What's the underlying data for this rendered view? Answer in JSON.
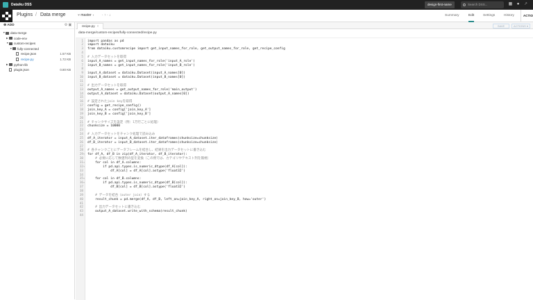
{
  "topbar": {
    "app_name": "Dataiku DSS",
    "instance_label": "design-first-name",
    "search_placeholder": "Search DSS...",
    "icons": [
      "apps-grid-icon",
      "notifications-icon",
      "user-avatar-icon",
      "activity-icon"
    ]
  },
  "header": {
    "section": "Plugins",
    "page": "Data merge",
    "branch": "master",
    "git_ops": "· ↑ · ↓",
    "tabs": [
      "Summary",
      "Edit",
      "Settings",
      "History"
    ],
    "active_tab": "Edit",
    "actions_label": "ACTIONS"
  },
  "sidebar": {
    "add_label": "ADD",
    "tree": [
      {
        "label": "data-merge",
        "type": "folder",
        "depth": 0,
        "expanded": true,
        "size": ""
      },
      {
        "label": "code-env",
        "type": "folder",
        "depth": 1,
        "expanded": false,
        "size": ""
      },
      {
        "label": "custom-recipes",
        "type": "folder",
        "depth": 1,
        "expanded": true,
        "size": ""
      },
      {
        "label": "fully-connected",
        "type": "folder",
        "depth": 2,
        "expanded": true,
        "size": ""
      },
      {
        "label": "recipe.json",
        "type": "file",
        "depth": 3,
        "size": "1.57 KB",
        "selected": false
      },
      {
        "label": "recipe.py",
        "type": "file",
        "depth": 3,
        "size": "1.72 KB",
        "selected": true
      },
      {
        "label": "python-lib",
        "type": "folder",
        "depth": 1,
        "expanded": false,
        "size": ""
      },
      {
        "label": "plugin.json",
        "type": "file",
        "depth": 1,
        "size": "0.80 KB",
        "selected": false
      }
    ]
  },
  "editor": {
    "tab_label": "recipe.py",
    "save_label": "SAVE",
    "more_label": "ACTIONS ▾",
    "file_path": "data-merge/custom-recipes/fully-connected/recipe.py",
    "lines": [
      "import pandas as pd",
      "import dataiku",
      "from dataiku.customrecipe import get_input_names_for_role, get_output_names_for_role, get_recipe_config",
      "",
      "# 入力データセットを取得",
      "input_A_names = get_input_names_for_role('input_A_role')",
      "input_B_names = get_input_names_for_role('input_B_role')",
      "",
      "input_A_dataset = dataiku.Dataset(input_A_names[0])",
      "input_B_dataset = dataiku.Dataset(input_B_names[0])",
      "",
      "# 出力データセットを取得",
      "output_A_names = get_output_names_for_role('main_output')",
      "output_A_dataset = dataiku.Dataset(output_A_names[0])",
      "",
      "# 設定されたjoin keyを取得",
      "config = get_recipe_config()",
      "join_key_A = config['join_key_A']",
      "join_key_B = config['join_key_B']",
      "",
      "# チャンクサイズを設定（例：1万行ごとに処理）",
      "chunksize = 10000",
      "",
      "# 入力データセットをチャンク処理で読み込み",
      "df_A_iterator = input_A_dataset.iter_dataframes(chunksize=chunksize)",
      "df_B_iterator = input_B_dataset.iter_dataframes(chunksize=chunksize)",
      "",
      "# 各チャンクごとにデータフレームを結合し、結果を出力データセットに書き込む",
      "for df_A, df_B in zip(df_A_iterator, df_B_iterator):",
      "    # 必要に応じて数値列の型を変換（この例では、カテゴリやテキスト列を無視）",
      "    for col in df_A.columns:",
      "        if pd.api.types.is_numeric_dtype(df_A[col]):",
      "            df_A[col] = df_A[col].astype('float32')",
      "",
      "    for col in df_B.columns:",
      "        if pd.api.types.is_numeric_dtype(df_B[col]):",
      "            df_B[col] = df_B[col].astype('float32')",
      "",
      "    # データを結合（outer join）する",
      "    result_chunk = pd.merge(df_A, df_B, left_on=join_key_A, right_on=join_key_B, how='outer')",
      "",
      "    # 出力データセットに書き込む",
      "    output_A_dataset.write_with_schema(result_chunk)",
      ""
    ],
    "fold_lines": [
      29,
      31,
      32,
      35,
      36
    ]
  }
}
